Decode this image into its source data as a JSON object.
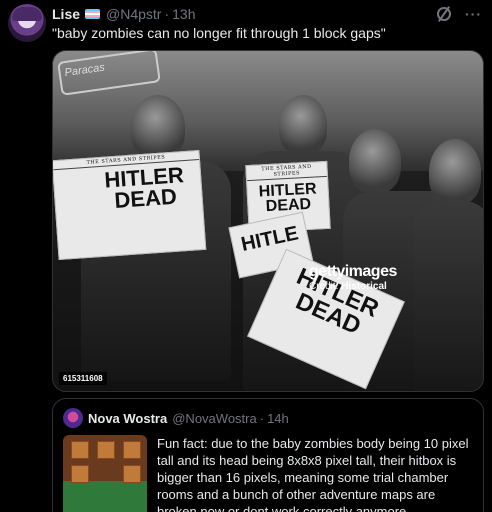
{
  "tweet": {
    "author_name": "Lise",
    "author_handle": "@N4pstr",
    "separator": "·",
    "time": "13h",
    "text": "\"baby zombies can no longer fit through 1 block gaps\"",
    "more_label": "···"
  },
  "photo": {
    "wall_sign": "Paracas",
    "paper_masthead": "THE STARS AND STRIPES",
    "headline_1": "HITLER DEAD",
    "headline_2": "HITLER DEAD",
    "headline_3": "HITLE",
    "headline_4": "HITLER DEAD",
    "watermark_logo": "gettyimages",
    "watermark_credit_label": "Credit:",
    "watermark_credit_value": "Historical",
    "image_id": "615311608"
  },
  "quote": {
    "author_name": "Nova Wostra",
    "author_handle": "@NovaWostra",
    "separator": "·",
    "time": "14h",
    "text": "Fun fact: due to the baby zombies body being 10 pixel tall and its head being 8x8x8 pixel tall, their hitbox is bigger than 16 pixels, meaning some trial chamber rooms and a bunch of other adventure maps are broken now or dont work correctly anymore."
  }
}
